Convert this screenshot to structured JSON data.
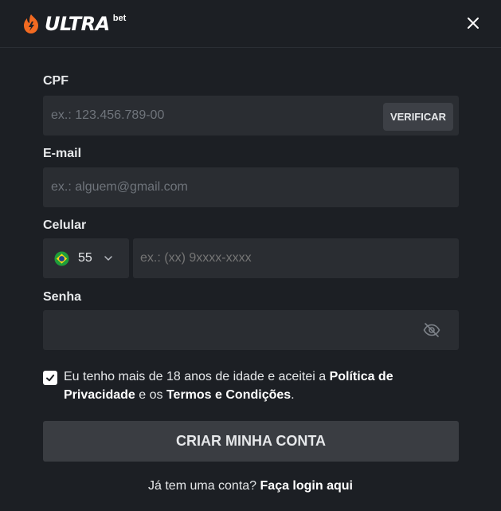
{
  "brand": {
    "name": "ULTRA",
    "sub": "bet",
    "color": "#f26a21"
  },
  "form": {
    "cpf": {
      "label": "CPF",
      "placeholder": "ex.: 123.456.789-00",
      "verify_label": "VERIFICAR"
    },
    "email": {
      "label": "E-mail",
      "placeholder": "ex.: alguem@gmail.com"
    },
    "phone": {
      "label": "Celular",
      "country_code": "55",
      "placeholder": "ex.: (xx) 9xxxx-xxxx"
    },
    "password": {
      "label": "Senha",
      "placeholder": ""
    },
    "terms": {
      "checked": true,
      "text_a": "Eu tenho mais de 18 anos de idade e aceitei a ",
      "privacy_link": "Política de Privacidade",
      "text_b": " e os ",
      "terms_link": "Termos e Condições",
      "text_c": "."
    },
    "submit_label": "CRIAR MINHA CONTA"
  },
  "footer": {
    "prompt": "Já tem uma conta? ",
    "login_link": "Faça login aqui"
  },
  "icons": {
    "close": "close-icon",
    "eye": "eye-off-icon",
    "chevron": "chevron-down-icon",
    "flag": "brazil-flag-icon",
    "check": "check-icon"
  }
}
